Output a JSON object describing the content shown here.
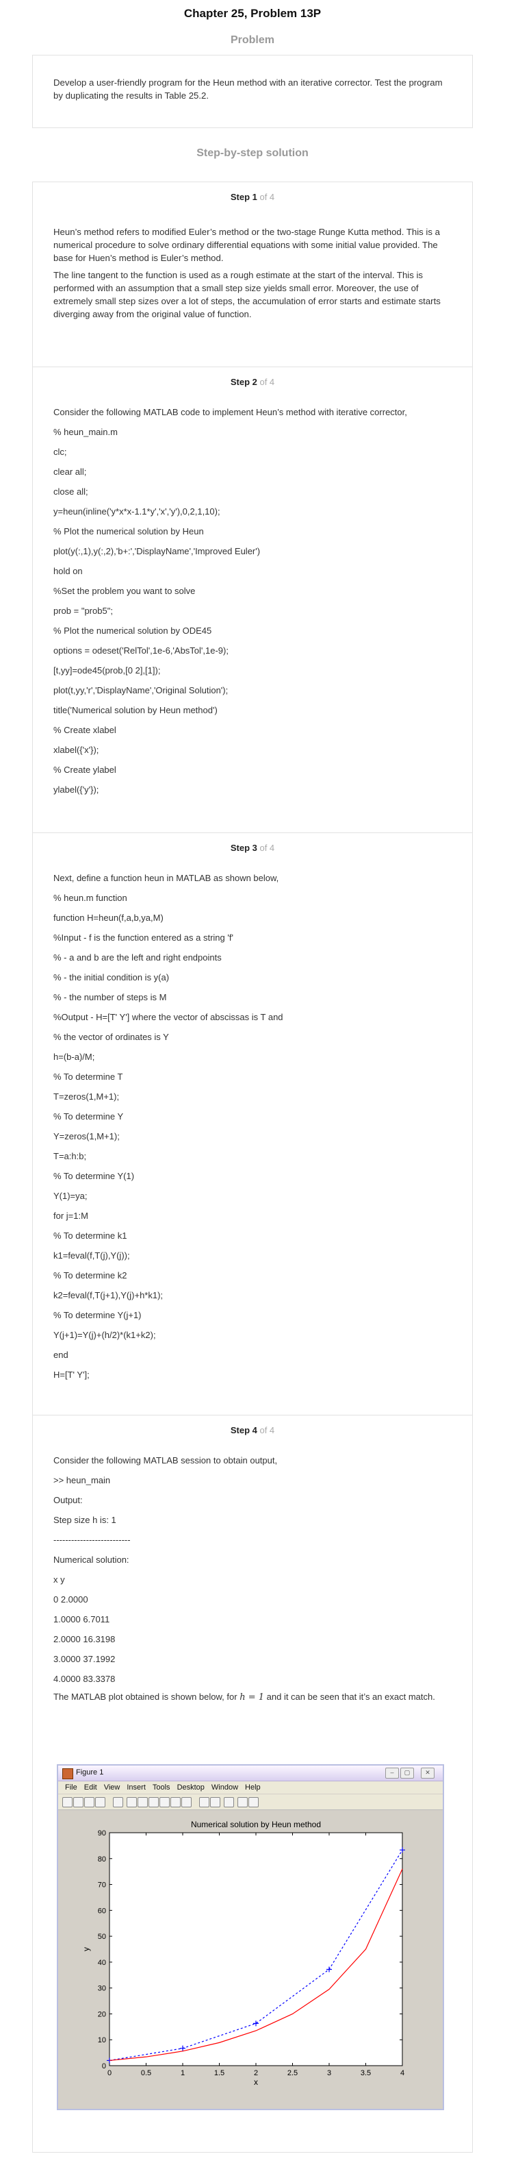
{
  "header": {
    "title": "Chapter 25, Problem 13P"
  },
  "problem": {
    "label": "Problem",
    "text": "Develop a user-friendly program for the Heun method with an iterative corrector. Test the program by duplicating the results in Table 25.2."
  },
  "solution_label": "Step-by-step solution",
  "steps": [
    {
      "num": "Step 1",
      "of": " of 4",
      "paras": [
        "Heun’s method refers to modified Euler’s method or the two-stage Runge Kutta method. This is a numerical procedure to solve ordinary differential equations with some initial value provided. The base for Huen’s method is Euler’s method.",
        "The line tangent to the function is used as a rough estimate at the start of the interval. This is performed with an assumption that a small step size yields small error. Moreover, the use of extremely small step sizes over a lot of steps, the accumulation of error starts and estimate starts diverging away from the original value of function."
      ]
    },
    {
      "num": "Step 2",
      "of": " of 4",
      "lines": [
        "Consider the following MATLAB code to implement Heun’s method with iterative corrector,",
        "% heun_main.m",
        "clc;",
        "clear all;",
        "close all;",
        "y=heun(inline('y*x*x-1.1*y','x','y'),0,2,1,10);",
        "% Plot the numerical solution by Heun",
        "plot(y(:,1),y(:,2),'b+:','DisplayName','Improved Euler')",
        "hold on",
        "%Set the problem you want to solve",
        "prob = \"prob5\";",
        "% Plot the numerical solution by ODE45",
        "options = odeset('RelTol',1e-6,'AbsTol',1e-9);",
        "[t,yy]=ode45(prob,[0 2],[1]);",
        "plot(t,yy,'r','DisplayName','Original Solution');",
        "title('Numerical solution by Heun method')",
        "% Create xlabel",
        "xlabel({'x'});",
        "% Create ylabel",
        "ylabel({'y'});"
      ]
    },
    {
      "num": "Step 3",
      "of": " of 4",
      "lines": [
        "Next, define a function heun in MATLAB as shown below,",
        "% heun.m function",
        "function H=heun(f,a,b,ya,M)",
        "%Input - f is the function entered as a string 'f'",
        "% - a and b are the left and right endpoints",
        "% - the initial condition is y(a)",
        "% - the number of steps is M",
        "%Output - H=[T' Y'] where the vector of abscissas is T and",
        "% the vector of ordinates is Y",
        "h=(b-a)/M;",
        "% To determine T",
        "T=zeros(1,M+1);",
        "% To determine Y",
        "Y=zeros(1,M+1);",
        "T=a:h:b;",
        "% To determine Y(1)",
        "Y(1)=ya;",
        "for j=1:M",
        "% To determine k1",
        "k1=feval(f,T(j),Y(j));",
        "% To determine k2",
        "k2=feval(f,T(j+1),Y(j)+h*k1);",
        "% To determine Y(j+1)",
        "Y(j+1)=Y(j)+(h/2)*(k1+k2);",
        "end",
        "H=[T' Y'];"
      ]
    },
    {
      "num": "Step 4",
      "of": " of 4",
      "lines": [
        "Consider the following MATLAB session to obtain output,",
        ">> heun_main",
        "Output:",
        "Step size h is: 1",
        "--------------------------",
        "Numerical solution:",
        "x y",
        "0 2.0000",
        "1.0000 6.7011",
        "2.0000 16.3198",
        "3.0000 37.1992",
        "4.0000 83.3378"
      ],
      "closing_a": "The MATLAB plot obtained is shown below, for",
      "closing_math": "h = 1",
      "closing_b": "and it can be seen that it’s an exact match."
    }
  ],
  "figure": {
    "window_title": "Figure 1",
    "menu": [
      "File",
      "Edit",
      "View",
      "Insert",
      "Tools",
      "Desktop",
      "Window",
      "Help"
    ],
    "colors": {
      "series_heun": "#0000ff",
      "series_ode": "#ff0000"
    }
  },
  "chart_data": {
    "type": "line",
    "title": "Numerical solution by Heun method",
    "xlabel": "x",
    "ylabel": "y",
    "xlim": [
      0,
      4
    ],
    "ylim": [
      0,
      90
    ],
    "xticks": [
      0,
      0.5,
      1,
      1.5,
      2,
      2.5,
      3,
      3.5,
      4
    ],
    "yticks": [
      0,
      10,
      20,
      30,
      40,
      50,
      60,
      70,
      80,
      90
    ],
    "grid": false,
    "series": [
      {
        "style": "dotted-plus",
        "color": "#0000ff",
        "x": [
          0,
          1,
          2,
          3,
          4
        ],
        "y": [
          2.0,
          6.7011,
          16.3198,
          37.1992,
          83.3378
        ]
      },
      {
        "style": "solid",
        "color": "#ff0000",
        "x": [
          0,
          0.5,
          1,
          1.5,
          2,
          2.5,
          3,
          3.5,
          4
        ],
        "y": [
          2.0,
          3.4,
          5.6,
          8.9,
          13.5,
          20.0,
          29.5,
          45.0,
          76.0
        ]
      }
    ]
  }
}
